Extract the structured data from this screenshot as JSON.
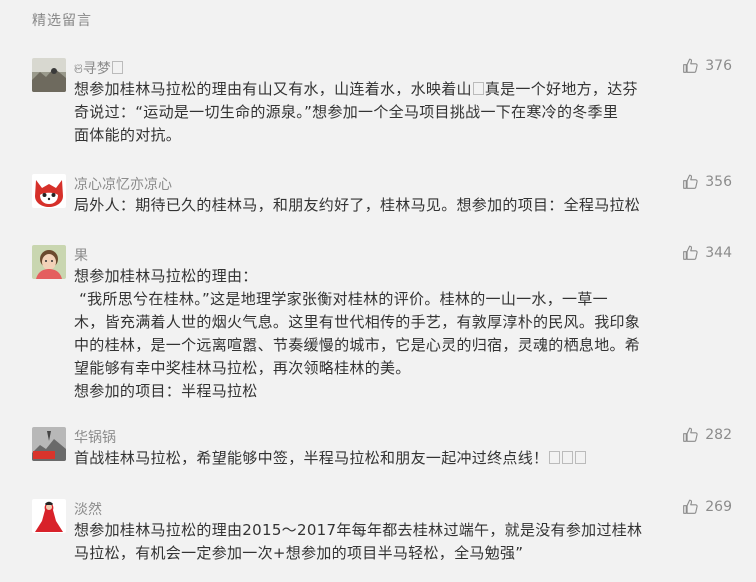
{
  "section_title": "精选留言",
  "comments": [
    {
      "nickname": "ଞ寻梦",
      "likes": "376",
      "content": "想参加桂林马拉松的理由有山又有水，山连着水，水映着山",
      "content_after_box": "真是一个好地方，达芬\n奇说过：“运动是一切生命的源泉。”想参加一个全马项目挑战一下在寒冷的冬季里\n面体能的对抗。"
    },
    {
      "nickname": "凉心凉忆亦凉心",
      "likes": "356",
      "content": "局外人：期待已久的桂林马，和朋友约好了，桂林马见。想参加的项目：全程马拉松"
    },
    {
      "nickname": "果",
      "likes": "344",
      "content": "想参加桂林马拉松的理由：\n “我所思兮在桂林。”这是地理学家张衡对桂林的评价。桂林的一山一水，一草一\n木，皆充满着人世的烟火气息。这里有世代相传的手艺，有敦厚淳朴的民风。我印象\n中的桂林，是一个远离喧嚣、节奏缓慢的城市，它是心灵的归宿，灵魂的栖息地。希\n望能够有幸中奖桂林马拉松，再次领略桂林的美。\n想参加的项目：半程马拉松"
    },
    {
      "nickname": "华锅锅",
      "likes": "282",
      "content": "首战桂林马拉松，希望能够中签，半程马拉松和朋友一起冲过终点线！"
    },
    {
      "nickname": "淡然",
      "likes": "269",
      "content": "想参加桂林马拉松的理由2015～2017年每年都去桂林过端午，就是没有参加过桂林\n马拉松，有机会一定参加一次+想参加的项目半马轻松，全马勉强”"
    }
  ],
  "icons": {
    "like": "thumbs-up-icon"
  },
  "colors": {
    "background": "#f2f2f2",
    "meta_text": "#8c8c8c",
    "body_text": "#333333"
  }
}
